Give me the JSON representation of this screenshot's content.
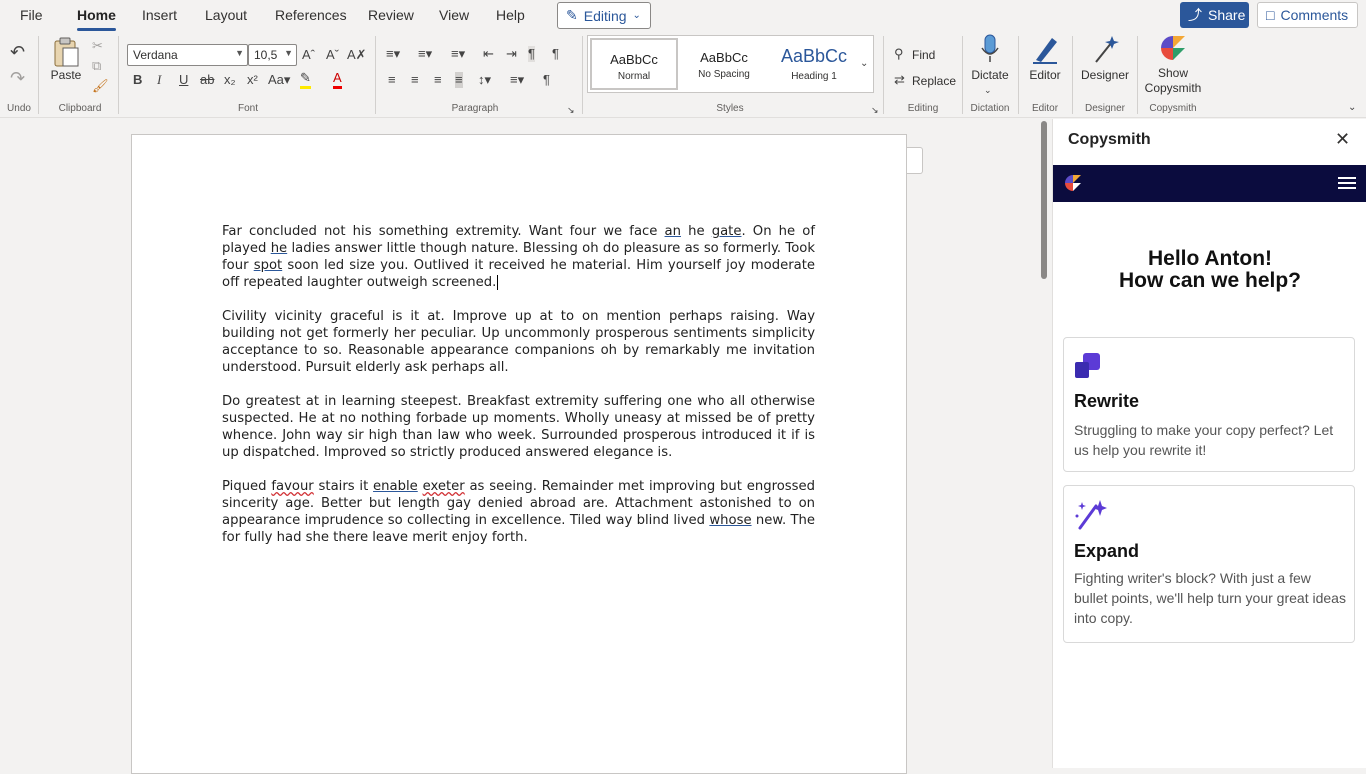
{
  "menu": {
    "file": "File",
    "home": "Home",
    "insert": "Insert",
    "layout": "Layout",
    "references": "References",
    "review": "Review",
    "view": "View",
    "help": "Help",
    "editing": "Editing",
    "share": "Share",
    "comments": "Comments"
  },
  "ribbon": {
    "undo_group": "Undo",
    "paste": "Paste",
    "clipboard_group": "Clipboard",
    "font_name": "Verdana",
    "font_size": "10,5",
    "font_group": "Font",
    "paragraph_group": "Paragraph",
    "styles": [
      {
        "sample": "AaBbCc",
        "name": "Normal"
      },
      {
        "sample": "AaBbCc",
        "name": "No Spacing"
      },
      {
        "sample": "AaBbCc",
        "name": "Heading 1"
      }
    ],
    "styles_group": "Styles",
    "find": "Find",
    "replace": "Replace",
    "editing_group": "Editing",
    "dictate": "Dictate",
    "dictation_group": "Dictation",
    "editor": "Editor",
    "editor_group": "Editor",
    "designer": "Designer",
    "designer_group": "Designer",
    "show_copysmith_1": "Show",
    "show_copysmith_2": "Copysmith",
    "copysmith_group": "Copysmith",
    "accent_color": "#2b579a"
  },
  "document": {
    "p1_a": "Far concluded not his something extremity. Want four we face ",
    "p1_an": "an",
    "p1_b": " he ",
    "p1_gate": "gate",
    "p1_c": ". On he of played ",
    "p1_he": "he",
    "p1_d": " ladies answer little though nature. Blessing oh do pleasure as so formerly. Took four ",
    "p1_spot": "spot",
    "p1_e": " soon led size you. Outlived it received he material. Him yourself joy moderate off repeated laughter outweigh screened.",
    "p2": "Civility vicinity graceful is it at. Improve up at to on mention perhaps raising. Way building not get formerly her peculiar. Up uncommonly prosperous sentiments simplicity acceptance to so. Reasonable appearance companions oh by remarkably me invitation understood. Pursuit elderly ask perhaps all.",
    "p3": "Do greatest at in learning steepest. Breakfast extremity suffering one who all otherwise suspected. He at no nothing forbade up moments. Wholly uneasy at missed be of pretty whence. John way sir high than law who week. Surrounded prosperous introduced it if is up dispatched. Improved so strictly produced answered elegance is.",
    "p4_a": "Piqued ",
    "p4_favour": "favour",
    "p4_b": " stairs it ",
    "p4_enable": "enable",
    "p4_sp": " ",
    "p4_exeter": "exeter",
    "p4_c": " as seeing. Remainder met improving but engrossed sincerity age. Better but length gay denied abroad are. Attachment astonished to on appearance imprudence so collecting in excellence. Tiled way blind lived ",
    "p4_whose": "whose",
    "p4_d": " new. The for fully had she there leave merit enjoy forth."
  },
  "pane": {
    "title": "Copysmith",
    "greeting_1": "Hello Anton!",
    "greeting_2": "How can we help?",
    "nav_color": "#0b0c3e",
    "cards": [
      {
        "title": "Rewrite",
        "desc": "Struggling to make your copy perfect? Let us help you rewrite it!"
      },
      {
        "title": "Expand",
        "desc": "Fighting writer's block? With just a few bullet points, we'll help turn your great ideas into copy."
      }
    ]
  }
}
